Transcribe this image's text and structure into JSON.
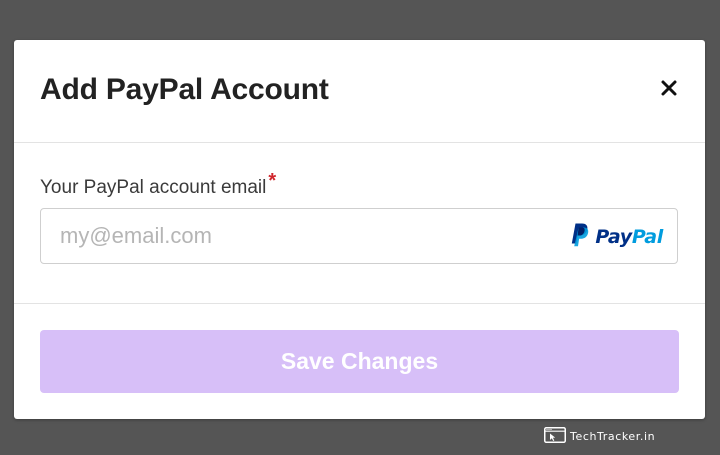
{
  "modal": {
    "title": "Add PayPal Account",
    "close_icon": "close-icon",
    "email_field": {
      "label": "Your PayPal account email",
      "required_mark": "*",
      "placeholder": "my@email.com",
      "value": "",
      "brand_logo": "paypal-logo",
      "brand_text_pay": "Pay",
      "brand_text_pal": "Pal"
    },
    "save_button": {
      "label": "Save Changes",
      "state": "disabled"
    }
  },
  "watermark": {
    "text": "TechTracker.in",
    "icon": "browser-cursor-icon"
  },
  "colors": {
    "backdrop": "#555555",
    "modal_bg": "#ffffff",
    "save_button_bg": "#d7bff8",
    "required_mark": "#d0262d",
    "paypal_dark_blue": "#003087",
    "paypal_light_blue": "#009cde"
  }
}
